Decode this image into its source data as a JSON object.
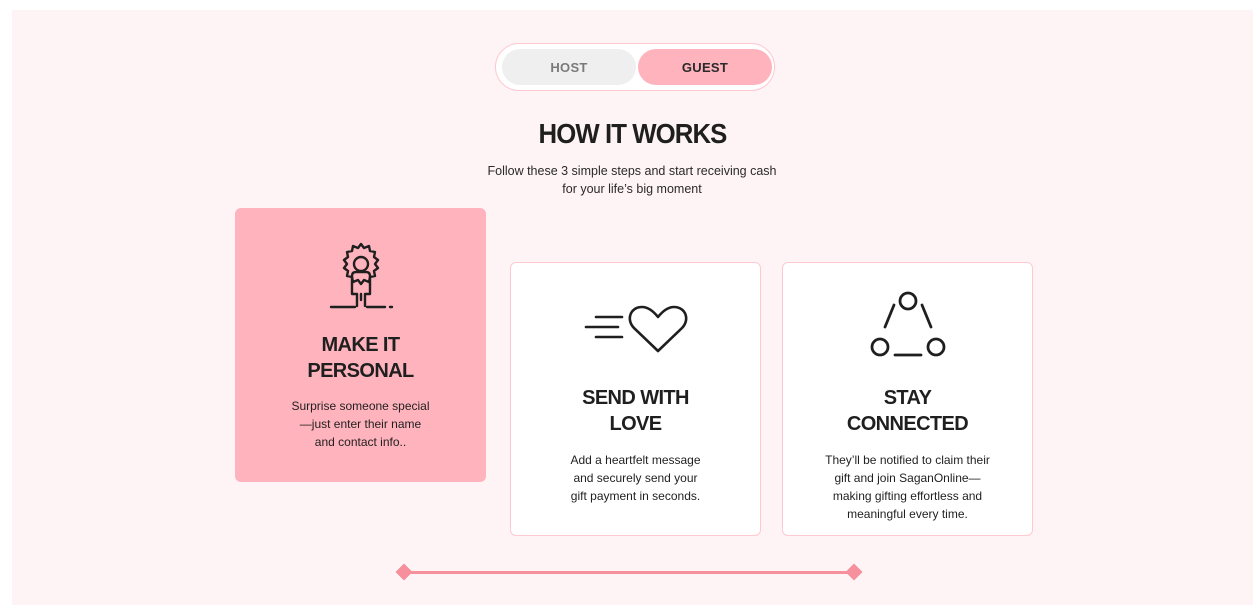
{
  "toggle": {
    "host_label": "HOST",
    "guest_label": "GUEST",
    "selected": "GUEST"
  },
  "header": {
    "title": "HOW IT WORKS",
    "subtitle_line1": "Follow these 3 simple steps and start receiving cash",
    "subtitle_line2": "for your life’s big moment"
  },
  "steps": [
    {
      "icon": "person-gear-icon",
      "title_line1": "MAKE IT",
      "title_line2": "PERSONAL",
      "text_line1": "Surprise someone special",
      "text_line2": "—just enter their name",
      "text_line3": "and contact info..",
      "active": true
    },
    {
      "icon": "send-heart-icon",
      "title_line1": "SEND WITH",
      "title_line2": "LOVE",
      "text_line1": "Add a heartfelt message",
      "text_line2": "and securely send your",
      "text_line3": "gift payment in seconds.",
      "active": false
    },
    {
      "icon": "connected-nodes-icon",
      "title_line1": "STAY",
      "title_line2": "CONNECTED",
      "text_line1": "They’ll be notified to claim their",
      "text_line2": "gift and join SaganOnline—",
      "text_line3": "making gifting effortless and",
      "text_line4": "meaningful every time.",
      "active": false
    }
  ],
  "colors": {
    "background": "#fff4f5",
    "accent_pink": "#ffb3bd",
    "slider_pink": "#f5909c",
    "card_border": "#ffc9d0",
    "text_dark": "#1f1f1f"
  }
}
